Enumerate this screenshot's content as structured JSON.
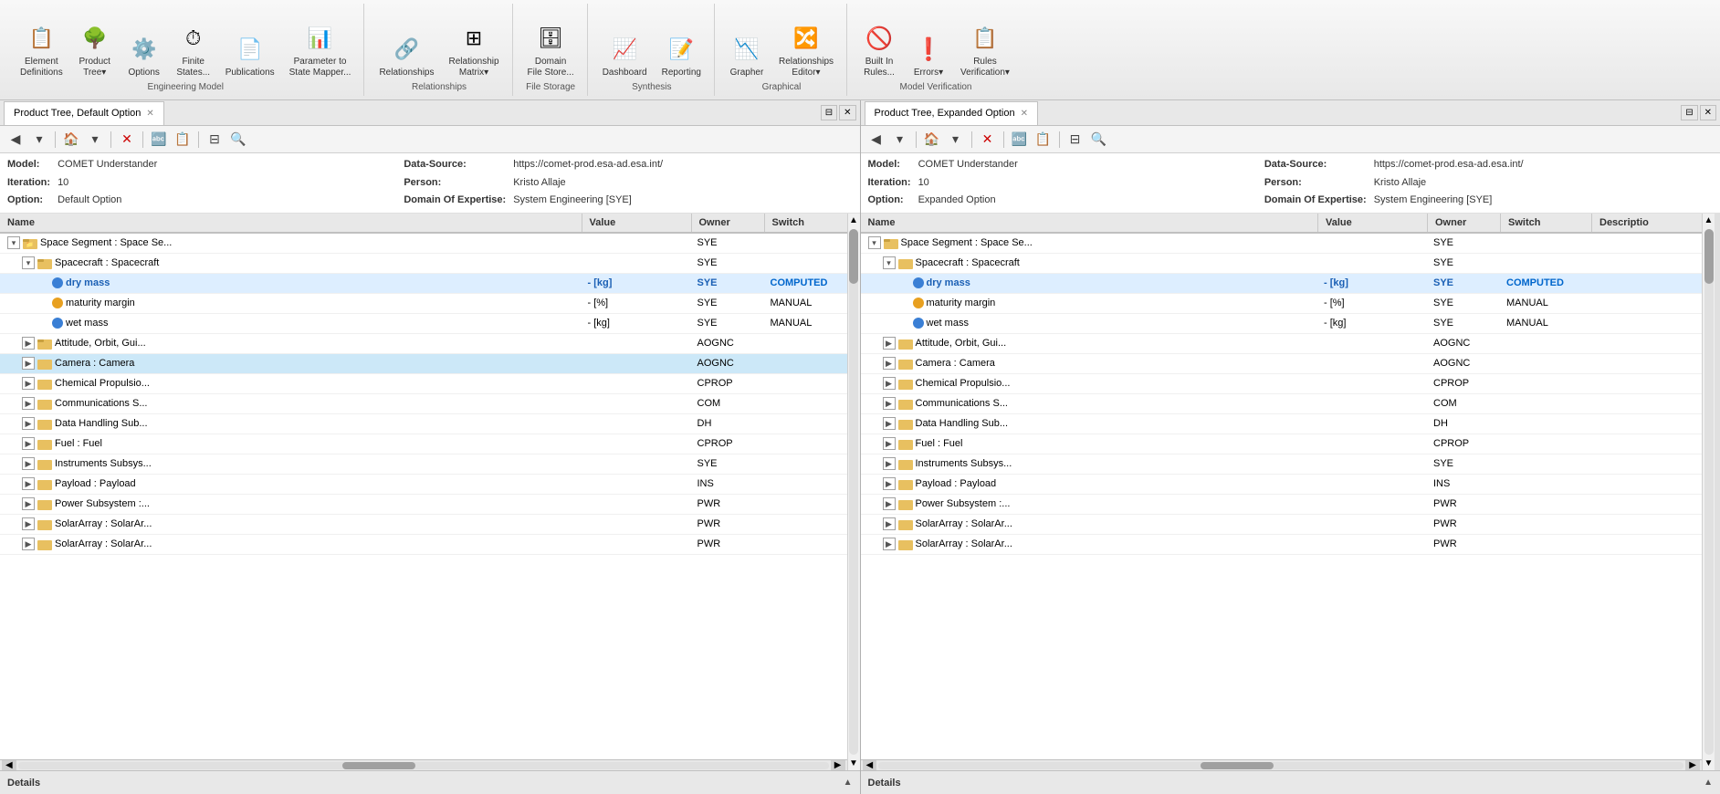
{
  "toolbar": {
    "groups": [
      {
        "label": "Engineering Model",
        "items": [
          {
            "id": "element-definitions",
            "icon": "📋",
            "label": "Element\nDefinitions"
          },
          {
            "id": "product-tree",
            "icon": "🌳",
            "label": "Product\nTree"
          },
          {
            "id": "options",
            "icon": "⚙️",
            "label": "Options"
          },
          {
            "id": "finite-states",
            "icon": "⏱",
            "label": "Finite\nStates..."
          },
          {
            "id": "publications",
            "icon": "📄",
            "label": "Publications"
          },
          {
            "id": "parameter-to-state",
            "icon": "📊",
            "label": "Parameter to\nState Mapper..."
          }
        ]
      },
      {
        "label": "Relationships",
        "items": [
          {
            "id": "relationships",
            "icon": "🔗",
            "label": "Relationships"
          },
          {
            "id": "relationship-matrix",
            "icon": "⊞",
            "label": "Relationship\nMatrix..."
          }
        ]
      },
      {
        "label": "File Storage",
        "items": [
          {
            "id": "domain-file-store",
            "icon": "🗄",
            "label": "Domain\nFile Store..."
          }
        ]
      },
      {
        "label": "Synthesis",
        "items": [
          {
            "id": "dashboard",
            "icon": "📈",
            "label": "Dashboard"
          },
          {
            "id": "reporting",
            "icon": "📝",
            "label": "Reporting"
          }
        ]
      },
      {
        "label": "Graphical",
        "items": [
          {
            "id": "grapher",
            "icon": "📉",
            "label": "Grapher"
          },
          {
            "id": "relationships-editor",
            "icon": "🔀",
            "label": "Relationships\nEditor..."
          }
        ]
      },
      {
        "label": "Model Verification",
        "items": [
          {
            "id": "built-in-rules",
            "icon": "🚫",
            "label": "Built In\nRules..."
          },
          {
            "id": "errors",
            "icon": "❗",
            "label": "Errors..."
          },
          {
            "id": "rules-verification",
            "icon": "✅",
            "label": "Rules\nVerification..."
          }
        ]
      }
    ]
  },
  "left_panel": {
    "tab_label": "Product Tree, Default Option",
    "model": "COMET Understander",
    "data_source": "https://comet-prod.esa-ad.esa.int/",
    "iteration": "10",
    "person": "Kristo Allaje",
    "option": "Default Option",
    "domain_of_expertise": "System Engineering [SYE]",
    "columns": [
      "Name",
      "Value",
      "Owner",
      "Switch"
    ],
    "tree_rows": [
      {
        "indent": 1,
        "expand": "collapse",
        "icon": "folder",
        "name": "Space Segment : Space Se...",
        "value": "",
        "owner": "SYE",
        "switch": ""
      },
      {
        "indent": 2,
        "expand": "collapse",
        "icon": "folder",
        "name": "Spacecraft : Spacecraft",
        "value": "",
        "owner": "SYE",
        "switch": ""
      },
      {
        "indent": 3,
        "expand": "none",
        "icon": "blue",
        "name": "dry mass",
        "value": "- [kg]",
        "owner": "SYE",
        "switch": "COMPUTED",
        "highlight": true
      },
      {
        "indent": 3,
        "expand": "none",
        "icon": "orange",
        "name": "maturity margin",
        "value": "- [%]",
        "owner": "SYE",
        "switch": "MANUAL"
      },
      {
        "indent": 3,
        "expand": "none",
        "icon": "blue",
        "name": "wet mass",
        "value": "- [kg]",
        "owner": "SYE",
        "switch": "MANUAL"
      },
      {
        "indent": 2,
        "expand": "expand",
        "icon": "folder",
        "name": "Attitude, Orbit, Gui...",
        "value": "",
        "owner": "AOGNC",
        "switch": ""
      },
      {
        "indent": 2,
        "expand": "expand",
        "icon": "folder",
        "name": "Camera : Camera",
        "value": "",
        "owner": "AOGNC",
        "switch": "",
        "selected": true
      },
      {
        "indent": 2,
        "expand": "expand",
        "icon": "folder",
        "name": "Chemical Propulsio...",
        "value": "",
        "owner": "CPROP",
        "switch": ""
      },
      {
        "indent": 2,
        "expand": "expand",
        "icon": "folder",
        "name": "Communications S...",
        "value": "",
        "owner": "COM",
        "switch": ""
      },
      {
        "indent": 2,
        "expand": "expand",
        "icon": "folder",
        "name": "Data Handling Sub...",
        "value": "",
        "owner": "DH",
        "switch": ""
      },
      {
        "indent": 2,
        "expand": "expand",
        "icon": "folder",
        "name": "Fuel : Fuel",
        "value": "",
        "owner": "CPROP",
        "switch": ""
      },
      {
        "indent": 2,
        "expand": "expand",
        "icon": "folder",
        "name": "Instruments Subsys...",
        "value": "",
        "owner": "SYE",
        "switch": ""
      },
      {
        "indent": 2,
        "expand": "expand",
        "icon": "folder",
        "name": "Payload : Payload",
        "value": "",
        "owner": "INS",
        "switch": ""
      },
      {
        "indent": 2,
        "expand": "expand",
        "icon": "folder",
        "name": "Power Subsystem :...",
        "value": "",
        "owner": "PWR",
        "switch": ""
      },
      {
        "indent": 2,
        "expand": "expand",
        "icon": "folder",
        "name": "SolarArray : SolarAr...",
        "value": "",
        "owner": "PWR",
        "switch": ""
      },
      {
        "indent": 2,
        "expand": "expand",
        "icon": "folder",
        "name": "SolarArray : SolarAr...",
        "value": "",
        "owner": "PWR",
        "switch": ""
      }
    ],
    "details_label": "Details"
  },
  "right_panel": {
    "tab_label": "Product Tree, Expanded Option",
    "model": "COMET Understander",
    "data_source": "https://comet-prod.esa-ad.esa.int/",
    "iteration": "10",
    "person": "Kristo Allaje",
    "option": "Expanded Option",
    "domain_of_expertise": "System Engineering [SYE]",
    "columns": [
      "Name",
      "Value",
      "Owner",
      "Switch",
      "Descriptio"
    ],
    "tree_rows": [
      {
        "indent": 1,
        "expand": "collapse",
        "icon": "folder",
        "name": "Space Segment : Space Se...",
        "value": "",
        "owner": "SYE",
        "switch": ""
      },
      {
        "indent": 2,
        "expand": "collapse",
        "icon": "folder",
        "name": "Spacecraft : Spacecraft",
        "value": "",
        "owner": "SYE",
        "switch": ""
      },
      {
        "indent": 3,
        "expand": "none",
        "icon": "blue",
        "name": "dry mass",
        "value": "- [kg]",
        "owner": "SYE",
        "switch": "COMPUTED",
        "highlight": true
      },
      {
        "indent": 3,
        "expand": "none",
        "icon": "orange",
        "name": "maturity margin",
        "value": "- [%]",
        "owner": "SYE",
        "switch": "MANUAL"
      },
      {
        "indent": 3,
        "expand": "none",
        "icon": "blue",
        "name": "wet mass",
        "value": "- [kg]",
        "owner": "SYE",
        "switch": "MANUAL"
      },
      {
        "indent": 2,
        "expand": "expand",
        "icon": "folder",
        "name": "Attitude, Orbit, Gui...",
        "value": "",
        "owner": "AOGNC",
        "switch": ""
      },
      {
        "indent": 2,
        "expand": "expand",
        "icon": "folder",
        "name": "Camera : Camera",
        "value": "",
        "owner": "AOGNC",
        "switch": ""
      },
      {
        "indent": 2,
        "expand": "expand",
        "icon": "folder",
        "name": "Chemical Propulsio...",
        "value": "",
        "owner": "CPROP",
        "switch": ""
      },
      {
        "indent": 2,
        "expand": "expand",
        "icon": "folder",
        "name": "Communications S...",
        "value": "",
        "owner": "COM",
        "switch": ""
      },
      {
        "indent": 2,
        "expand": "expand",
        "icon": "folder",
        "name": "Data Handling Sub...",
        "value": "",
        "owner": "DH",
        "switch": ""
      },
      {
        "indent": 2,
        "expand": "expand",
        "icon": "folder",
        "name": "Fuel : Fuel",
        "value": "",
        "owner": "CPROP",
        "switch": ""
      },
      {
        "indent": 2,
        "expand": "expand",
        "icon": "folder",
        "name": "Instruments Subsys...",
        "value": "",
        "owner": "SYE",
        "switch": ""
      },
      {
        "indent": 2,
        "expand": "expand",
        "icon": "folder",
        "name": "Payload : Payload",
        "value": "",
        "owner": "INS",
        "switch": ""
      },
      {
        "indent": 2,
        "expand": "expand",
        "icon": "folder",
        "name": "Power Subsystem :...",
        "value": "",
        "owner": "PWR",
        "switch": ""
      },
      {
        "indent": 2,
        "expand": "expand",
        "icon": "folder",
        "name": "SolarArray : SolarAr...",
        "value": "",
        "owner": "PWR",
        "switch": ""
      },
      {
        "indent": 2,
        "expand": "expand",
        "icon": "folder",
        "name": "SolarArray : SolarAr...",
        "value": "",
        "owner": "PWR",
        "switch": ""
      }
    ],
    "details_label": "Details"
  }
}
